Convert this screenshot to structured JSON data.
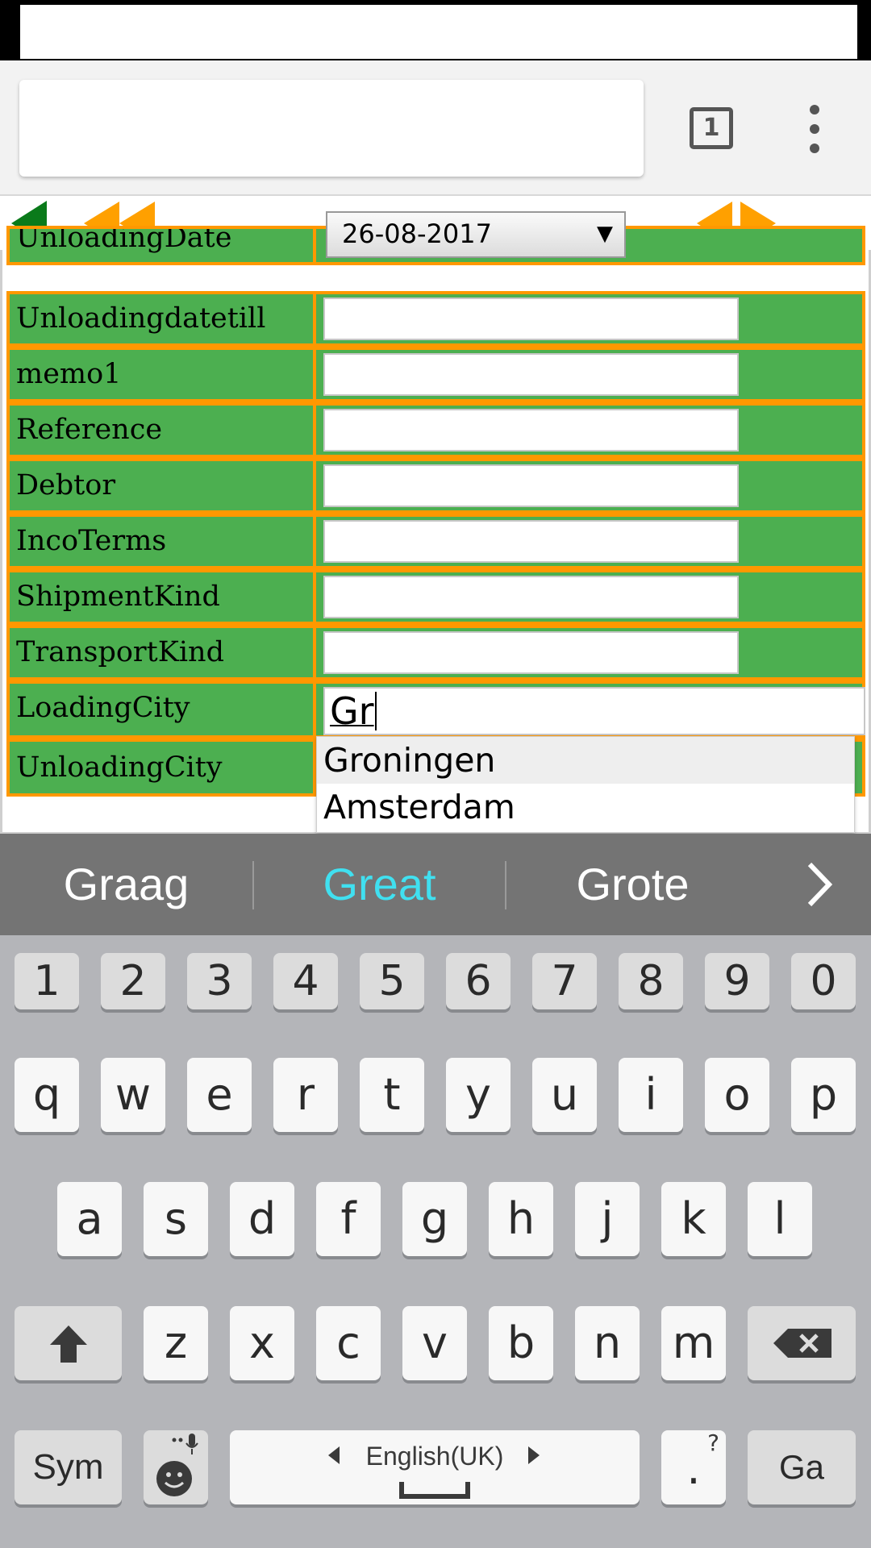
{
  "browser": {
    "tab_count": "1"
  },
  "form": {
    "rows": [
      {
        "label": "UnloadingDate",
        "value": "26-08-2017",
        "type": "date"
      },
      {
        "label": "Unloadingdatetill",
        "value": "",
        "type": "text"
      },
      {
        "label": "memo1",
        "value": "",
        "type": "text"
      },
      {
        "label": "Reference",
        "value": "",
        "type": "text"
      },
      {
        "label": "Debtor",
        "value": "",
        "type": "text"
      },
      {
        "label": "IncoTerms",
        "value": "",
        "type": "text"
      },
      {
        "label": "ShipmentKind",
        "value": "",
        "type": "text"
      },
      {
        "label": "TransportKind",
        "value": "",
        "type": "text"
      },
      {
        "label": "LoadingCity",
        "value": "Gr",
        "type": "autocomplete"
      },
      {
        "label": "UnloadingCity",
        "value": "",
        "type": "text"
      }
    ],
    "date_arrow": "▼",
    "autocomplete_options": [
      "Groningen",
      "Amsterdam"
    ]
  },
  "keyboard": {
    "suggestions": [
      "Graag",
      "Great",
      "Grote"
    ],
    "suggestion_highlight_color": "#40e0f0",
    "number_row": [
      "1",
      "2",
      "3",
      "4",
      "5",
      "6",
      "7",
      "8",
      "9",
      "0"
    ],
    "row1": [
      "q",
      "w",
      "e",
      "r",
      "t",
      "y",
      "u",
      "i",
      "o",
      "p"
    ],
    "row2": [
      "a",
      "s",
      "d",
      "f",
      "g",
      "h",
      "j",
      "k",
      "l"
    ],
    "row3": [
      "z",
      "x",
      "c",
      "v",
      "b",
      "n",
      "m"
    ],
    "sym_label": "Sym",
    "space_label": "English(UK)",
    "period_label": ".",
    "period_hint": "?",
    "enter_label": "Ga"
  },
  "colors": {
    "nav_back": "#0a7a1a",
    "nav_arrows": "#ffa000",
    "row_bg": "#4caf50",
    "row_border": "#ff9800"
  }
}
